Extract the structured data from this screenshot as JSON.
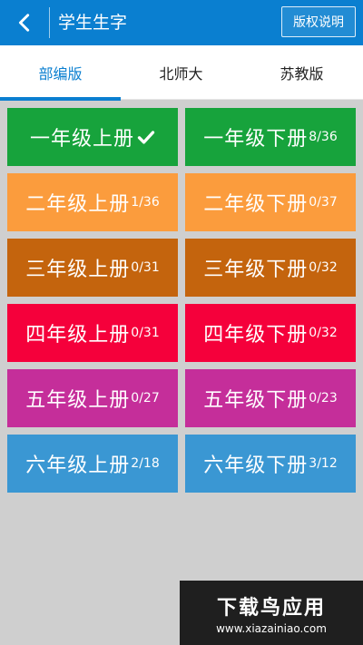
{
  "topbar": {
    "title": "学生生字",
    "copyright_label": "版权说明",
    "color": "#0a7fd0"
  },
  "tabs": [
    {
      "label": "部编版",
      "active": true
    },
    {
      "label": "北师大",
      "active": false
    },
    {
      "label": "苏教版",
      "active": false
    }
  ],
  "tiles": [
    {
      "name": "一年级上册",
      "count": "",
      "checked": true,
      "color": "#17a33c"
    },
    {
      "name": "一年级下册",
      "count": "8/36",
      "checked": false,
      "color": "#17a33c"
    },
    {
      "name": "二年级上册",
      "count": "1/36",
      "checked": false,
      "color": "#fb9c3d"
    },
    {
      "name": "二年级下册",
      "count": "0/37",
      "checked": false,
      "color": "#fb9c3d"
    },
    {
      "name": "三年级上册",
      "count": "0/31",
      "checked": false,
      "color": "#c4640d"
    },
    {
      "name": "三年级下册",
      "count": "0/32",
      "checked": false,
      "color": "#c4640d"
    },
    {
      "name": "四年级上册",
      "count": "0/31",
      "checked": false,
      "color": "#f5003b"
    },
    {
      "name": "四年级下册",
      "count": "0/32",
      "checked": false,
      "color": "#f5003b"
    },
    {
      "name": "五年级上册",
      "count": "0/27",
      "checked": false,
      "color": "#c52e9a"
    },
    {
      "name": "五年级下册",
      "count": "0/23",
      "checked": false,
      "color": "#c52e9a"
    },
    {
      "name": "六年级上册",
      "count": "2/18",
      "checked": false,
      "color": "#3a97d3"
    },
    {
      "name": "六年级下册",
      "count": "3/12",
      "checked": false,
      "color": "#3a97d3"
    }
  ],
  "watermark": {
    "main": "下载鸟应用",
    "sub": "www.xiazainiao.com"
  }
}
